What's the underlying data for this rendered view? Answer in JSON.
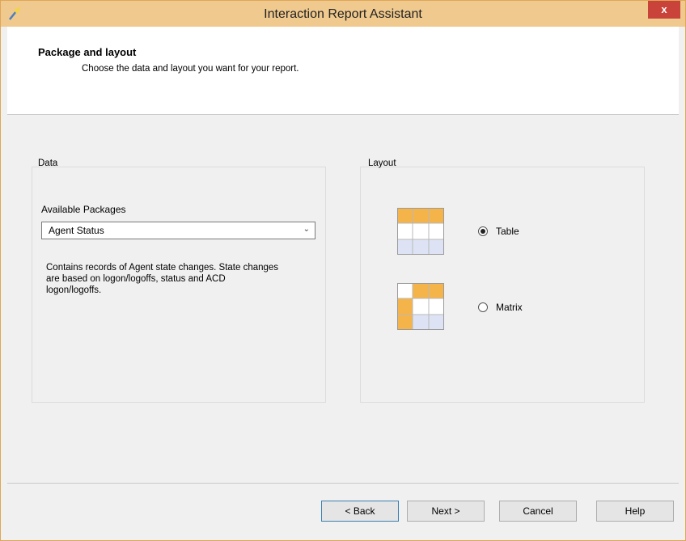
{
  "window": {
    "title": "Interaction Report Assistant",
    "close_symbol": "x"
  },
  "header": {
    "title": "Package and layout",
    "subtitle": "Choose the data and layout you want for your report."
  },
  "data_group": {
    "title": "Data",
    "packages_label": "Available Packages",
    "selected_package": "Agent Status",
    "description": "Contains records of Agent state changes. State changes are based on logon/logoffs, status and ACD logon/logoffs."
  },
  "layout_group": {
    "title": "Layout",
    "options": [
      {
        "label": "Table",
        "selected": true,
        "icon": "table-layout-icon"
      },
      {
        "label": "Matrix",
        "selected": false,
        "icon": "matrix-layout-icon"
      }
    ]
  },
  "buttons": {
    "back": "< Back",
    "next": "Next >",
    "cancel": "Cancel",
    "help": "Help"
  },
  "colors": {
    "titlebar": "#f0c98e",
    "close": "#c9433a",
    "grid_accent": "#f5b44a",
    "grid_base": "#dde3f4"
  }
}
